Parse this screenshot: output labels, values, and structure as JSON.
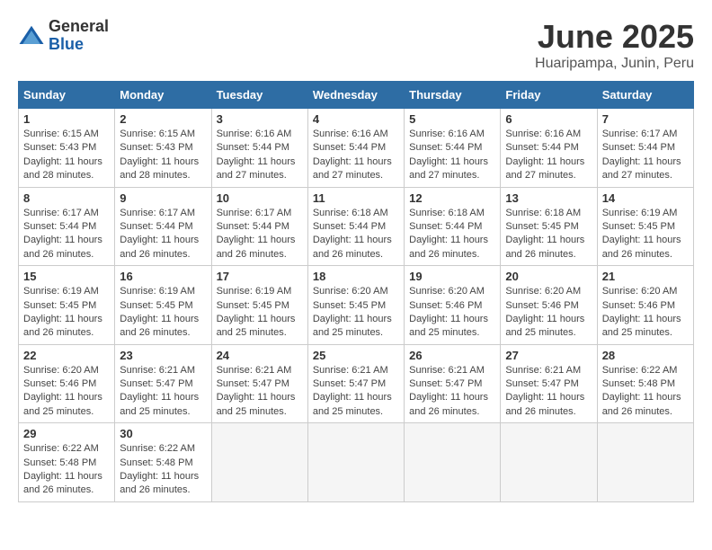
{
  "logo": {
    "general": "General",
    "blue": "Blue"
  },
  "title": "June 2025",
  "location": "Huaripampa, Junin, Peru",
  "days_of_week": [
    "Sunday",
    "Monday",
    "Tuesday",
    "Wednesday",
    "Thursday",
    "Friday",
    "Saturday"
  ],
  "weeks": [
    [
      {
        "day": "1",
        "sunrise": "6:15 AM",
        "sunset": "5:43 PM",
        "daylight": "11 hours and 28 minutes."
      },
      {
        "day": "2",
        "sunrise": "6:15 AM",
        "sunset": "5:43 PM",
        "daylight": "11 hours and 28 minutes."
      },
      {
        "day": "3",
        "sunrise": "6:16 AM",
        "sunset": "5:44 PM",
        "daylight": "11 hours and 27 minutes."
      },
      {
        "day": "4",
        "sunrise": "6:16 AM",
        "sunset": "5:44 PM",
        "daylight": "11 hours and 27 minutes."
      },
      {
        "day": "5",
        "sunrise": "6:16 AM",
        "sunset": "5:44 PM",
        "daylight": "11 hours and 27 minutes."
      },
      {
        "day": "6",
        "sunrise": "6:16 AM",
        "sunset": "5:44 PM",
        "daylight": "11 hours and 27 minutes."
      },
      {
        "day": "7",
        "sunrise": "6:17 AM",
        "sunset": "5:44 PM",
        "daylight": "11 hours and 27 minutes."
      }
    ],
    [
      {
        "day": "8",
        "sunrise": "6:17 AM",
        "sunset": "5:44 PM",
        "daylight": "11 hours and 26 minutes."
      },
      {
        "day": "9",
        "sunrise": "6:17 AM",
        "sunset": "5:44 PM",
        "daylight": "11 hours and 26 minutes."
      },
      {
        "day": "10",
        "sunrise": "6:17 AM",
        "sunset": "5:44 PM",
        "daylight": "11 hours and 26 minutes."
      },
      {
        "day": "11",
        "sunrise": "6:18 AM",
        "sunset": "5:44 PM",
        "daylight": "11 hours and 26 minutes."
      },
      {
        "day": "12",
        "sunrise": "6:18 AM",
        "sunset": "5:44 PM",
        "daylight": "11 hours and 26 minutes."
      },
      {
        "day": "13",
        "sunrise": "6:18 AM",
        "sunset": "5:45 PM",
        "daylight": "11 hours and 26 minutes."
      },
      {
        "day": "14",
        "sunrise": "6:19 AM",
        "sunset": "5:45 PM",
        "daylight": "11 hours and 26 minutes."
      }
    ],
    [
      {
        "day": "15",
        "sunrise": "6:19 AM",
        "sunset": "5:45 PM",
        "daylight": "11 hours and 26 minutes."
      },
      {
        "day": "16",
        "sunrise": "6:19 AM",
        "sunset": "5:45 PM",
        "daylight": "11 hours and 26 minutes."
      },
      {
        "day": "17",
        "sunrise": "6:19 AM",
        "sunset": "5:45 PM",
        "daylight": "11 hours and 25 minutes."
      },
      {
        "day": "18",
        "sunrise": "6:20 AM",
        "sunset": "5:45 PM",
        "daylight": "11 hours and 25 minutes."
      },
      {
        "day": "19",
        "sunrise": "6:20 AM",
        "sunset": "5:46 PM",
        "daylight": "11 hours and 25 minutes."
      },
      {
        "day": "20",
        "sunrise": "6:20 AM",
        "sunset": "5:46 PM",
        "daylight": "11 hours and 25 minutes."
      },
      {
        "day": "21",
        "sunrise": "6:20 AM",
        "sunset": "5:46 PM",
        "daylight": "11 hours and 25 minutes."
      }
    ],
    [
      {
        "day": "22",
        "sunrise": "6:20 AM",
        "sunset": "5:46 PM",
        "daylight": "11 hours and 25 minutes."
      },
      {
        "day": "23",
        "sunrise": "6:21 AM",
        "sunset": "5:47 PM",
        "daylight": "11 hours and 25 minutes."
      },
      {
        "day": "24",
        "sunrise": "6:21 AM",
        "sunset": "5:47 PM",
        "daylight": "11 hours and 25 minutes."
      },
      {
        "day": "25",
        "sunrise": "6:21 AM",
        "sunset": "5:47 PM",
        "daylight": "11 hours and 25 minutes."
      },
      {
        "day": "26",
        "sunrise": "6:21 AM",
        "sunset": "5:47 PM",
        "daylight": "11 hours and 26 minutes."
      },
      {
        "day": "27",
        "sunrise": "6:21 AM",
        "sunset": "5:47 PM",
        "daylight": "11 hours and 26 minutes."
      },
      {
        "day": "28",
        "sunrise": "6:22 AM",
        "sunset": "5:48 PM",
        "daylight": "11 hours and 26 minutes."
      }
    ],
    [
      {
        "day": "29",
        "sunrise": "6:22 AM",
        "sunset": "5:48 PM",
        "daylight": "11 hours and 26 minutes."
      },
      {
        "day": "30",
        "sunrise": "6:22 AM",
        "sunset": "5:48 PM",
        "daylight": "11 hours and 26 minutes."
      },
      null,
      null,
      null,
      null,
      null
    ]
  ]
}
